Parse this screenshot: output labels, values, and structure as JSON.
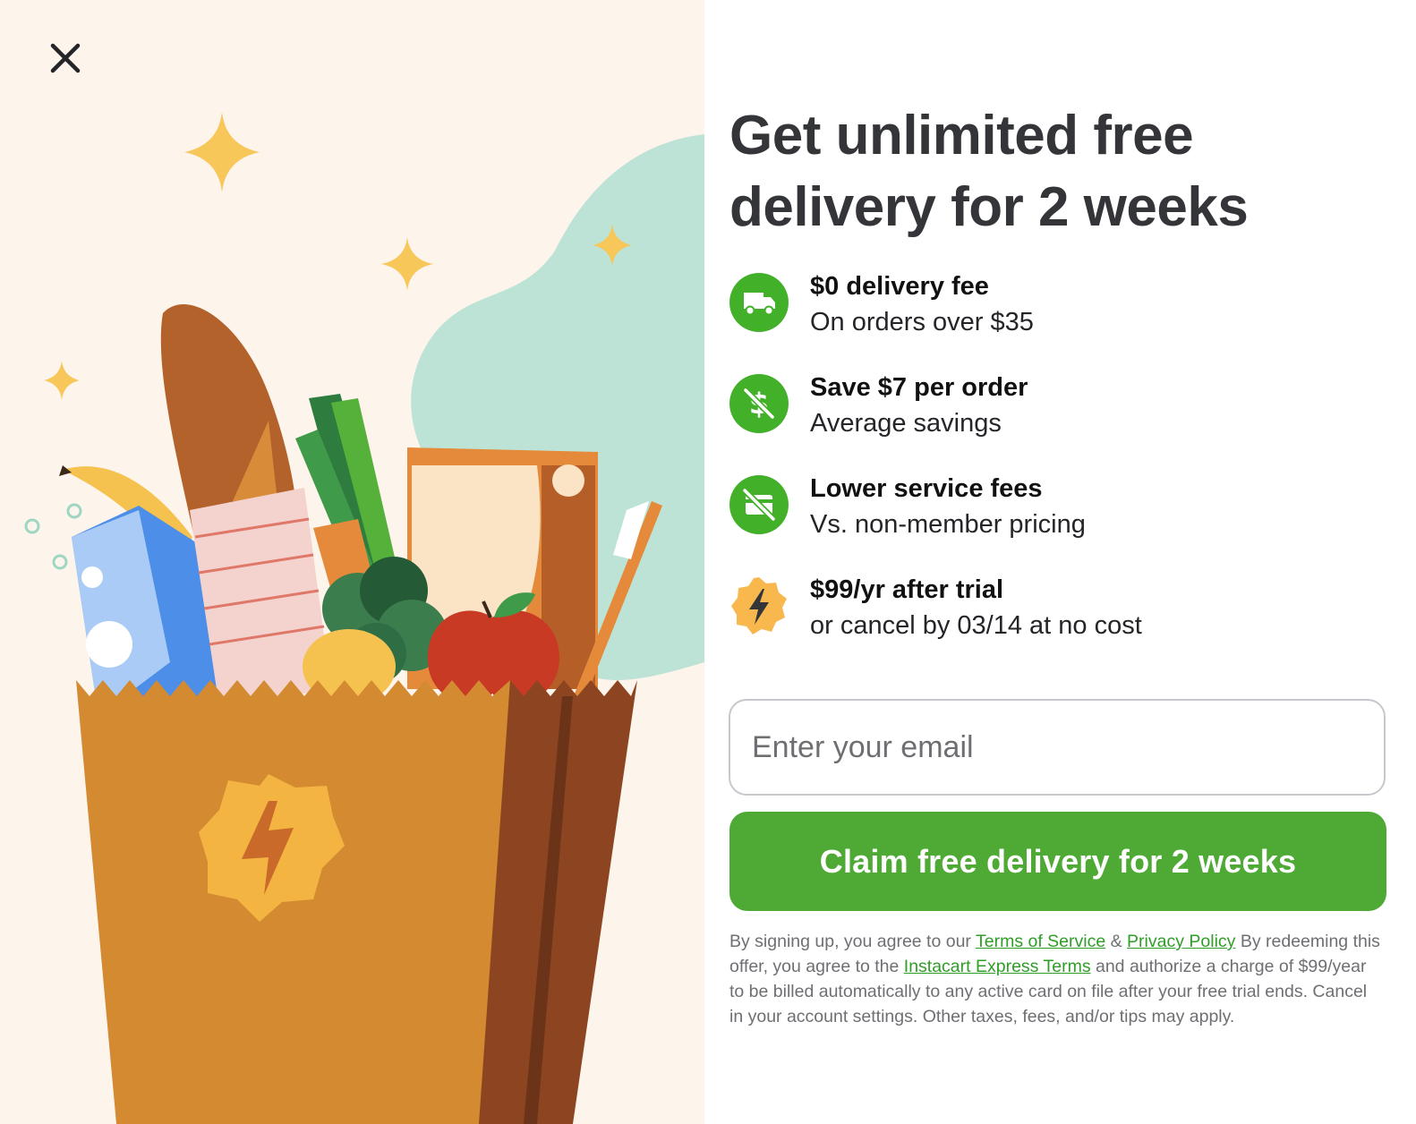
{
  "headline": "Get unlimited free delivery for 2 weeks",
  "benefits": [
    {
      "title": "$0 delivery fee",
      "subtitle": "On orders over $35",
      "icon": "delivery-truck-icon"
    },
    {
      "title": "Save $7 per order",
      "subtitle": "Average savings",
      "icon": "dollar-slash-icon"
    },
    {
      "title": "Lower service fees",
      "subtitle": "Vs. non-member pricing",
      "icon": "fee-card-slash-icon"
    },
    {
      "title": "$99/yr after trial",
      "subtitle": "or cancel by 03/14 at no cost",
      "icon": "lightning-badge-icon"
    }
  ],
  "email": {
    "placeholder": "Enter your email",
    "value": ""
  },
  "cta_label": "Claim free delivery for 2 weeks",
  "legal": {
    "t1": "By signing up, you agree to our ",
    "terms_link": "Terms of Service",
    "t2": " & ",
    "privacy_link": "Privacy Policy",
    "t3": " By redeeming this offer, you agree to the ",
    "express_link": "Instacart Express Terms",
    "t4": " and authorize a charge of $99/year to be billed automatically to any active card on file after your free trial ends. Cancel in your account settings. Other taxes, fees, and/or tips may apply."
  },
  "colors": {
    "brand_green": "#4fa935",
    "icon_green": "#43b02a",
    "link_green": "#2f9e27",
    "badge_yellow": "#f8b84e",
    "panel_bg": "#fdf4ec"
  }
}
